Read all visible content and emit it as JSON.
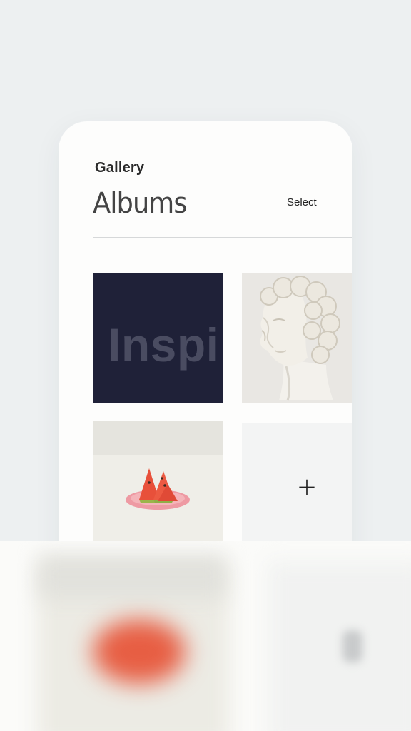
{
  "header": {
    "section_title": "Gallery",
    "page_title": "Albums",
    "select_label": "Select"
  },
  "albums": [
    {
      "name": "inspiration",
      "cover_text": "Inspi"
    },
    {
      "name": "statue"
    },
    {
      "name": "watermelon"
    }
  ],
  "add_album": {
    "icon": "+"
  },
  "colors": {
    "background": "#edf0f1",
    "card": "#fdfdfc",
    "inspiration_tile": "#1f2138",
    "accent_melon": "#e75e43"
  }
}
